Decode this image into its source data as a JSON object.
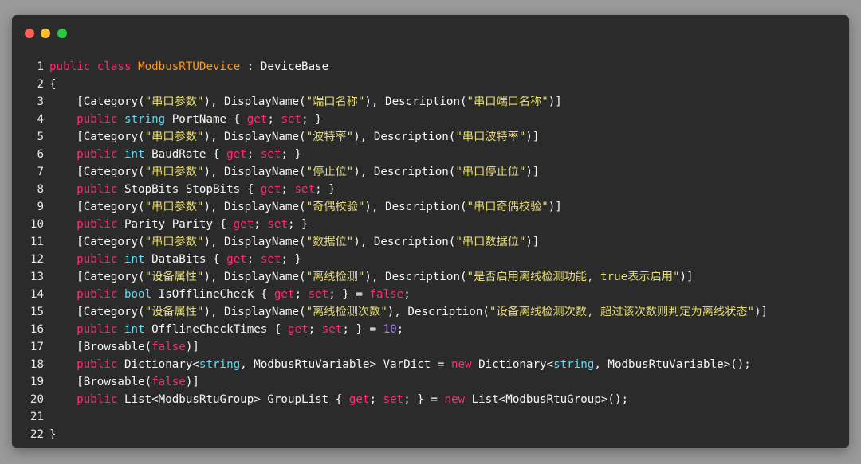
{
  "window": {
    "controls": [
      "close",
      "minimize",
      "maximize"
    ]
  },
  "colors": {
    "background": "#9a9a9a",
    "editor": "#2b2b2b",
    "keyword": "#ff2d6e",
    "type": "#67d8ef",
    "class_name": "#fd971f",
    "string": "#e6db74",
    "number": "#ae81ff",
    "plain": "#f8f8f2"
  },
  "code": {
    "lines": [
      {
        "n": "1",
        "tokens": [
          [
            "kw",
            "public"
          ],
          [
            "pl",
            " "
          ],
          [
            "kw",
            "class"
          ],
          [
            "pl",
            " "
          ],
          [
            "cls",
            "ModbusRTUDevice"
          ],
          [
            "pl",
            " : DeviceBase"
          ]
        ]
      },
      {
        "n": "2",
        "tokens": [
          [
            "pl",
            "{"
          ]
        ]
      },
      {
        "n": "3",
        "tokens": [
          [
            "pl",
            "    [Category("
          ],
          [
            "str",
            "\"串口参数\""
          ],
          [
            "pl",
            "), DisplayName("
          ],
          [
            "str",
            "\"端口名称\""
          ],
          [
            "pl",
            "), Description("
          ],
          [
            "str",
            "\"串口端口名称\""
          ],
          [
            "pl",
            ")]"
          ]
        ]
      },
      {
        "n": "4",
        "tokens": [
          [
            "pl",
            "    "
          ],
          [
            "kw",
            "public"
          ],
          [
            "pl",
            " "
          ],
          [
            "ty",
            "string"
          ],
          [
            "pl",
            " PortName { "
          ],
          [
            "kw",
            "get"
          ],
          [
            "pl",
            "; "
          ],
          [
            "kw",
            "set"
          ],
          [
            "pl",
            "; }"
          ]
        ]
      },
      {
        "n": "5",
        "tokens": [
          [
            "pl",
            "    [Category("
          ],
          [
            "str",
            "\"串口参数\""
          ],
          [
            "pl",
            "), DisplayName("
          ],
          [
            "str",
            "\"波特率\""
          ],
          [
            "pl",
            "), Description("
          ],
          [
            "str",
            "\"串口波特率\""
          ],
          [
            "pl",
            ")]"
          ]
        ]
      },
      {
        "n": "6",
        "tokens": [
          [
            "pl",
            "    "
          ],
          [
            "kw",
            "public"
          ],
          [
            "pl",
            " "
          ],
          [
            "ty",
            "int"
          ],
          [
            "pl",
            " BaudRate { "
          ],
          [
            "kw",
            "get"
          ],
          [
            "pl",
            "; "
          ],
          [
            "kw",
            "set"
          ],
          [
            "pl",
            "; }"
          ]
        ]
      },
      {
        "n": "7",
        "tokens": [
          [
            "pl",
            "    [Category("
          ],
          [
            "str",
            "\"串口参数\""
          ],
          [
            "pl",
            "), DisplayName("
          ],
          [
            "str",
            "\"停止位\""
          ],
          [
            "pl",
            "), Description("
          ],
          [
            "str",
            "\"串口停止位\""
          ],
          [
            "pl",
            ")]"
          ]
        ]
      },
      {
        "n": "8",
        "tokens": [
          [
            "pl",
            "    "
          ],
          [
            "kw",
            "public"
          ],
          [
            "pl",
            " StopBits StopBits { "
          ],
          [
            "kw",
            "get"
          ],
          [
            "pl",
            "; "
          ],
          [
            "kw",
            "set"
          ],
          [
            "pl",
            "; }"
          ]
        ]
      },
      {
        "n": "9",
        "tokens": [
          [
            "pl",
            "    [Category("
          ],
          [
            "str",
            "\"串口参数\""
          ],
          [
            "pl",
            "), DisplayName("
          ],
          [
            "str",
            "\"奇偶校验\""
          ],
          [
            "pl",
            "), Description("
          ],
          [
            "str",
            "\"串口奇偶校验\""
          ],
          [
            "pl",
            ")]"
          ]
        ]
      },
      {
        "n": "10",
        "tokens": [
          [
            "pl",
            "    "
          ],
          [
            "kw",
            "public"
          ],
          [
            "pl",
            " Parity Parity { "
          ],
          [
            "kw",
            "get"
          ],
          [
            "pl",
            "; "
          ],
          [
            "kw",
            "set"
          ],
          [
            "pl",
            "; }"
          ]
        ]
      },
      {
        "n": "11",
        "tokens": [
          [
            "pl",
            "    [Category("
          ],
          [
            "str",
            "\"串口参数\""
          ],
          [
            "pl",
            "), DisplayName("
          ],
          [
            "str",
            "\"数据位\""
          ],
          [
            "pl",
            "), Description("
          ],
          [
            "str",
            "\"串口数据位\""
          ],
          [
            "pl",
            ")]"
          ]
        ]
      },
      {
        "n": "12",
        "tokens": [
          [
            "pl",
            "    "
          ],
          [
            "kw",
            "public"
          ],
          [
            "pl",
            " "
          ],
          [
            "ty",
            "int"
          ],
          [
            "pl",
            " DataBits { "
          ],
          [
            "kw",
            "get"
          ],
          [
            "pl",
            "; "
          ],
          [
            "kw",
            "set"
          ],
          [
            "pl",
            "; }"
          ]
        ]
      },
      {
        "n": "13",
        "tokens": [
          [
            "pl",
            "    [Category("
          ],
          [
            "str",
            "\"设备属性\""
          ],
          [
            "pl",
            "), DisplayName("
          ],
          [
            "str",
            "\"离线检测\""
          ],
          [
            "pl",
            "), Description("
          ],
          [
            "str",
            "\"是否启用离线检测功能, true表示启用\""
          ],
          [
            "pl",
            ")]"
          ]
        ]
      },
      {
        "n": "14",
        "tokens": [
          [
            "pl",
            "    "
          ],
          [
            "kw",
            "public"
          ],
          [
            "pl",
            " "
          ],
          [
            "ty",
            "bool"
          ],
          [
            "pl",
            " IsOfflineCheck { "
          ],
          [
            "kw",
            "get"
          ],
          [
            "pl",
            "; "
          ],
          [
            "kw",
            "set"
          ],
          [
            "pl",
            "; } = "
          ],
          [
            "kw",
            "false"
          ],
          [
            "pl",
            ";"
          ]
        ]
      },
      {
        "n": "15",
        "tokens": [
          [
            "pl",
            "    [Category("
          ],
          [
            "str",
            "\"设备属性\""
          ],
          [
            "pl",
            "), DisplayName("
          ],
          [
            "str",
            "\"离线检测次数\""
          ],
          [
            "pl",
            "), Description("
          ],
          [
            "str",
            "\"设备离线检测次数, 超过该次数则判定为离线状态\""
          ],
          [
            "pl",
            ")]"
          ]
        ]
      },
      {
        "n": "16",
        "tokens": [
          [
            "pl",
            "    "
          ],
          [
            "kw",
            "public"
          ],
          [
            "pl",
            " "
          ],
          [
            "ty",
            "int"
          ],
          [
            "pl",
            " OfflineCheckTimes { "
          ],
          [
            "kw",
            "get"
          ],
          [
            "pl",
            "; "
          ],
          [
            "kw",
            "set"
          ],
          [
            "pl",
            "; } = "
          ],
          [
            "num",
            "10"
          ],
          [
            "pl",
            ";"
          ]
        ]
      },
      {
        "n": "17",
        "tokens": [
          [
            "pl",
            "    [Browsable("
          ],
          [
            "kw",
            "false"
          ],
          [
            "pl",
            ")]"
          ]
        ]
      },
      {
        "n": "18",
        "tokens": [
          [
            "pl",
            "    "
          ],
          [
            "kw",
            "public"
          ],
          [
            "pl",
            " Dictionary<"
          ],
          [
            "ty",
            "string"
          ],
          [
            "pl",
            ", ModbusRtuVariable> VarDict = "
          ],
          [
            "kw",
            "new"
          ],
          [
            "pl",
            " Dictionary<"
          ],
          [
            "ty",
            "string"
          ],
          [
            "pl",
            ", ModbusRtuVariable>();"
          ]
        ]
      },
      {
        "n": "19",
        "tokens": [
          [
            "pl",
            "    [Browsable("
          ],
          [
            "kw",
            "false"
          ],
          [
            "pl",
            ")]"
          ]
        ]
      },
      {
        "n": "20",
        "tokens": [
          [
            "pl",
            "    "
          ],
          [
            "kw",
            "public"
          ],
          [
            "pl",
            " List<ModbusRtuGroup> GroupList { "
          ],
          [
            "kw",
            "get"
          ],
          [
            "pl",
            "; "
          ],
          [
            "kw",
            "set"
          ],
          [
            "pl",
            "; } = "
          ],
          [
            "kw",
            "new"
          ],
          [
            "pl",
            " List<ModbusRtuGroup>();"
          ]
        ]
      },
      {
        "n": "21",
        "tokens": [
          [
            "pl",
            ""
          ]
        ]
      },
      {
        "n": "22",
        "tokens": [
          [
            "pl",
            "}"
          ]
        ]
      }
    ]
  }
}
